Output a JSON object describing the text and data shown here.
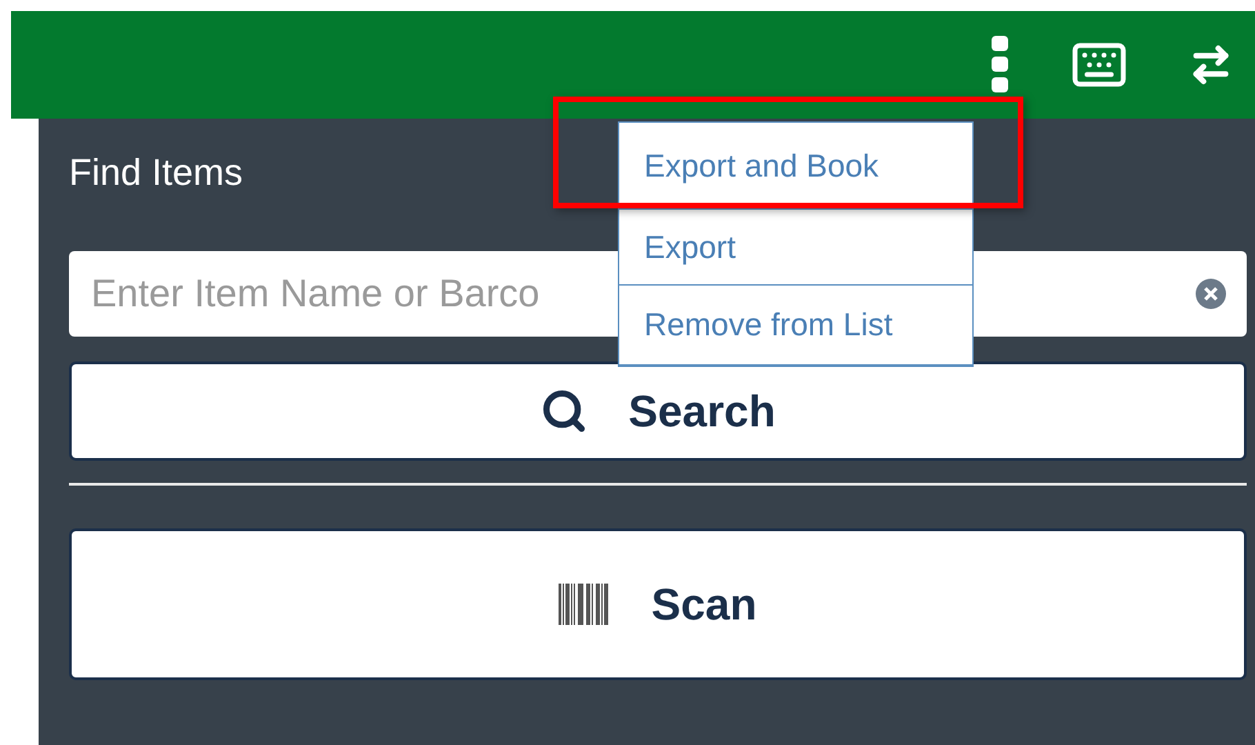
{
  "panel": {
    "title": "Find Items",
    "search_field": {
      "placeholder": "Enter Item Name or Barco"
    },
    "search_button": "Search",
    "scan_button": "Scan"
  },
  "menu": {
    "items": [
      {
        "label": "Export and Book",
        "highlighted": true
      },
      {
        "label": "Export",
        "highlighted": false
      },
      {
        "label": "Remove from List",
        "highlighted": false
      }
    ]
  }
}
